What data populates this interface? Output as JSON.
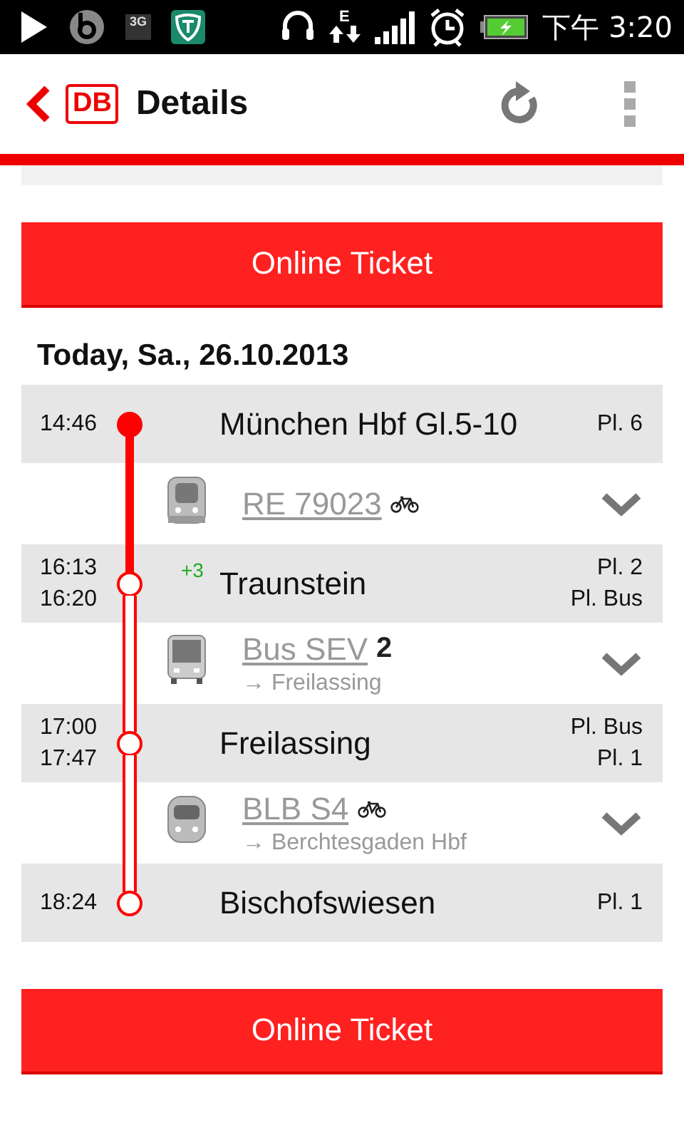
{
  "status_bar": {
    "network_type": "3G",
    "data_type": "E",
    "time": "下午 3:20"
  },
  "app_bar": {
    "logo": "DB",
    "title": "Details"
  },
  "top_button": "Online Ticket",
  "date": "Today, Sa., 26.10.2013",
  "itinerary": [
    {
      "kind": "stop",
      "times": [
        "14:46"
      ],
      "name": "München Hbf Gl.5-10",
      "platforms": [
        "Pl. 6"
      ],
      "reached": true
    },
    {
      "kind": "train",
      "name": "RE 79023",
      "bike": true,
      "passed": true
    },
    {
      "kind": "stop",
      "times": [
        "16:13",
        "16:20"
      ],
      "delay": "+3",
      "name": "Traunstein",
      "platforms": [
        "Pl. 2",
        "Pl. Bus"
      ],
      "reached": false
    },
    {
      "kind": "bus",
      "name": "Bus SEV",
      "number": "2",
      "direction": "→ Freilassing",
      "bike": false,
      "passed": false
    },
    {
      "kind": "stop",
      "times": [
        "17:00",
        "17:47"
      ],
      "name": "Freilassing",
      "platforms": [
        "Pl. Bus",
        "Pl. 1"
      ],
      "reached": false
    },
    {
      "kind": "tram",
      "name": "BLB S4",
      "direction": "→ Berchtesgaden Hbf",
      "bike": true,
      "passed": false
    },
    {
      "kind": "stop",
      "times": [
        "18:24"
      ],
      "name": "Bischofswiesen",
      "platforms": [
        "Pl. 1"
      ],
      "reached": false
    }
  ],
  "bottom_button": "Online Ticket"
}
